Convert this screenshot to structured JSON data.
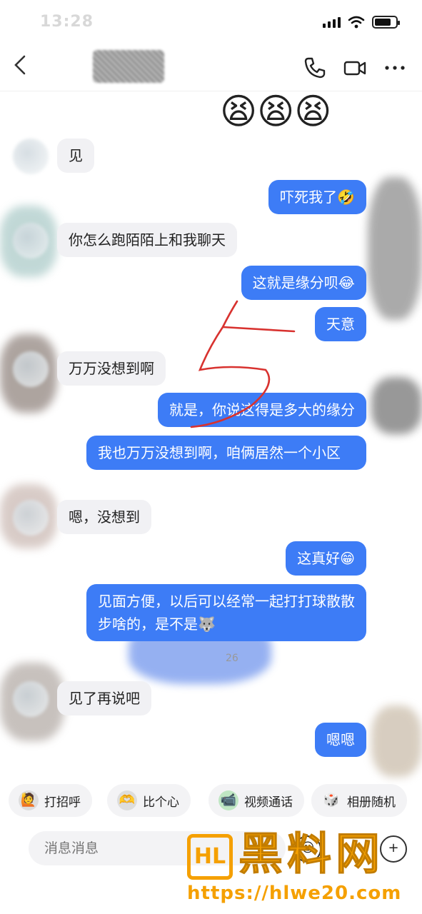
{
  "status_bar": {
    "time": "13:28"
  },
  "nav": {
    "back_icon": "chevron-left-icon",
    "call_icon": "phone-icon",
    "video_icon": "video-camera-icon",
    "more_icon": "more-dots-icon"
  },
  "messages": [
    {
      "side": "out",
      "kind": "emoji",
      "text": "😫😫😫"
    },
    {
      "side": "in",
      "text": "见"
    },
    {
      "side": "out",
      "text": "吓死我了🤣"
    },
    {
      "side": "in",
      "text": "你怎么跑陌陌上和我聊天"
    },
    {
      "side": "out",
      "text": "这就是缘分呗😂"
    },
    {
      "side": "out",
      "text": "天意"
    },
    {
      "side": "in",
      "text": "万万没想到啊"
    },
    {
      "side": "out",
      "text": "就是，你说这得是多大的缘分"
    },
    {
      "side": "out",
      "text": "我也万万没想到啊，咱俩居然一个小区"
    },
    {
      "side": "in",
      "text": "嗯，没想到"
    },
    {
      "side": "out",
      "text": "这真好😁"
    },
    {
      "side": "out",
      "text": "见面方便，以后可以经常一起打打球散散步啥的，是不是🐺"
    },
    {
      "side": "time",
      "text": "26"
    },
    {
      "side": "in",
      "text": "见了再说吧"
    },
    {
      "side": "out",
      "text": "嗯嗯"
    }
  ],
  "quick_actions": [
    {
      "label": "打招呼",
      "icon": "person-wave-icon"
    },
    {
      "label": "比个心",
      "icon": "person-heart-icon"
    },
    {
      "label": "视频通话",
      "icon": "video-call-icon"
    },
    {
      "label": "相册随机",
      "icon": "dice-icon"
    }
  ],
  "input": {
    "placeholder": "消息消息",
    "emoji_icon": "smile-icon",
    "plus_icon": "plus-icon"
  },
  "watermark": {
    "logo_text": "HL",
    "title": "黑料网",
    "url": "https://hlwe20.com"
  },
  "colors": {
    "outgoing_bubble": "#3d7cf6",
    "incoming_bubble": "#f1f1f4",
    "watermark": "#f5a000"
  }
}
